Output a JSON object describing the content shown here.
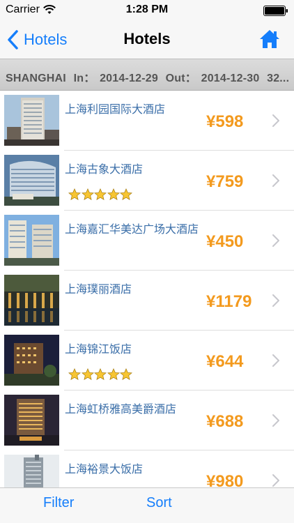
{
  "status_bar": {
    "carrier": "Carrier",
    "time": "1:28 PM"
  },
  "nav": {
    "back_label": "Hotels",
    "title": "Hotels",
    "home_icon": "home-icon"
  },
  "filter": {
    "city": "SHANGHAI",
    "in_label": "In：",
    "in_date": "2014-12-29",
    "out_label": "Out：",
    "out_date": "2014-12-30",
    "extra": "32..."
  },
  "hotels": [
    {
      "name": "上海利园国际大酒店",
      "price": "¥598",
      "stars": 0
    },
    {
      "name": "上海古象大酒店",
      "price": "¥759",
      "stars": 5
    },
    {
      "name": "上海嘉汇华美达广场大酒店",
      "price": "¥450",
      "stars": 0
    },
    {
      "name": "上海璞丽酒店",
      "price": "¥1179",
      "stars": 0
    },
    {
      "name": "上海锦江饭店",
      "price": "¥644",
      "stars": 5
    },
    {
      "name": "上海虹桥雅高美爵酒店",
      "price": "¥688",
      "stars": 0
    },
    {
      "name": "上海裕景大饭店",
      "price": "¥980",
      "stars": 0
    }
  ],
  "tabs": {
    "filter_label": "Filter",
    "sort_label": "Sort"
  },
  "colors": {
    "accent": "#157efb",
    "price": "#f39a1e",
    "hotel_name": "#3a6ea8"
  }
}
